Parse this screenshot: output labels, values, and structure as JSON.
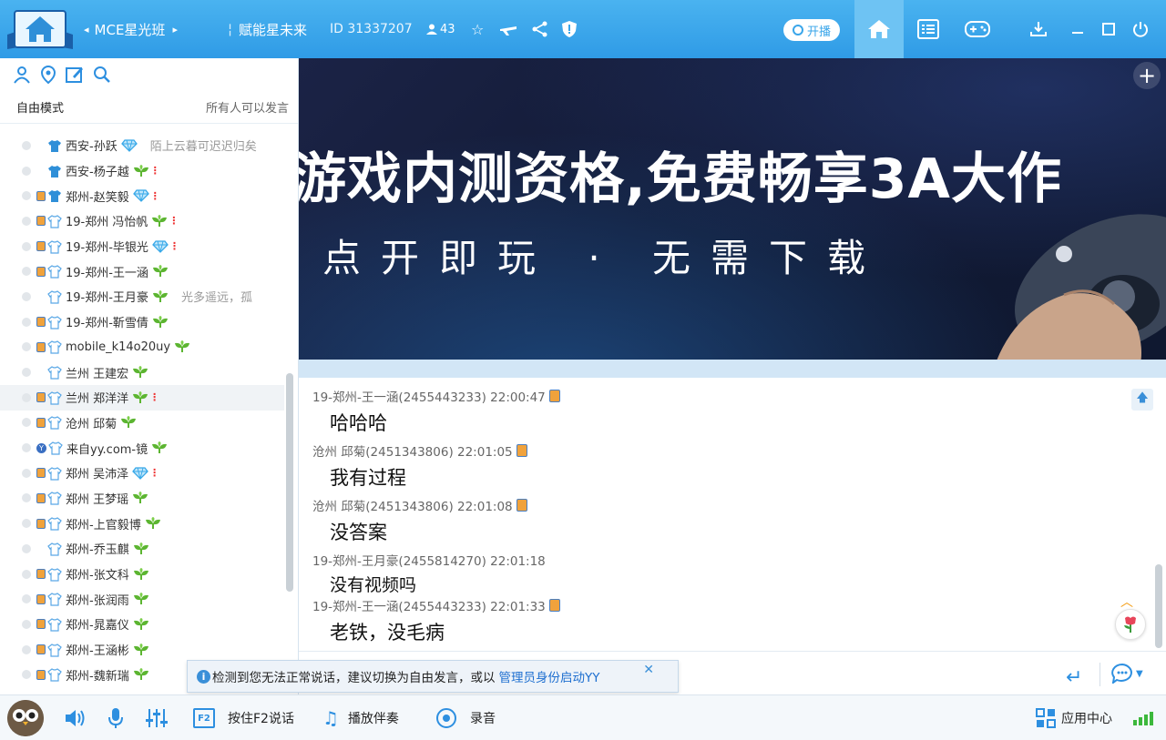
{
  "titlebar": {
    "channel_name": "MCE星光班",
    "sub_channel": "赋能星未来",
    "channel_id": "ID 31337207",
    "online_count": "43",
    "live_label": "开播"
  },
  "left": {
    "mode": "自由模式",
    "mode_desc": "所有人可以发言",
    "members": [
      {
        "name": "西安-孙跃",
        "sign": "陌上云暮可迟迟归矣",
        "dev": false,
        "tag": "diamond",
        "excl": false,
        "shirt": "#2f8fd8"
      },
      {
        "name": "西安-杨子越",
        "sign": "",
        "dev": false,
        "tag": "leaf",
        "excl": true,
        "shirt": "#2f8fd8"
      },
      {
        "name": "郑州-赵笑毅",
        "sign": "",
        "dev": true,
        "tag": "diamond",
        "excl": true,
        "shirt": "#2f8fd8"
      },
      {
        "name": "19-郑州  冯怡帆",
        "sign": "",
        "dev": true,
        "tag": "leaf",
        "excl": true,
        "shirt": "outline"
      },
      {
        "name": "19-郑州-毕银光",
        "sign": "",
        "dev": true,
        "tag": "diamond",
        "excl": true,
        "shirt": "outline"
      },
      {
        "name": "19-郑州-王一涵",
        "sign": "",
        "dev": true,
        "tag": "leaf",
        "excl": false,
        "shirt": "outline"
      },
      {
        "name": "19-郑州-王月豪",
        "sign": "光多遥远，孤",
        "dev": false,
        "tag": "leaf",
        "excl": false,
        "shirt": "outline"
      },
      {
        "name": "19-郑州-靳雪倩",
        "sign": "",
        "dev": true,
        "tag": "leaf",
        "excl": false,
        "shirt": "outline"
      },
      {
        "name": "mobile_k14o20uy",
        "sign": "",
        "dev": true,
        "tag": "leaf",
        "excl": false,
        "shirt": "outline"
      },
      {
        "name": "兰州  王建宏",
        "sign": "",
        "dev": false,
        "tag": "leaf",
        "excl": false,
        "shirt": "outline"
      },
      {
        "name": "兰州 郑洋洋",
        "sign": "",
        "dev": true,
        "tag": "leaf",
        "excl": true,
        "shirt": "outline",
        "hl": true
      },
      {
        "name": "沧州 邱菊",
        "sign": "",
        "dev": true,
        "tag": "leaf",
        "excl": false,
        "shirt": "outline"
      },
      {
        "name": "来自yy.com-镜",
        "sign": "",
        "dev": "yy",
        "tag": "leaf",
        "excl": false,
        "shirt": "outline"
      },
      {
        "name": "郑州 吴沛泽",
        "sign": "",
        "dev": true,
        "tag": "diamond",
        "excl": true,
        "shirt": "outline"
      },
      {
        "name": "郑州 王梦瑶",
        "sign": "",
        "dev": true,
        "tag": "leaf",
        "excl": false,
        "shirt": "outline"
      },
      {
        "name": "郑州-上官毅博",
        "sign": "",
        "dev": true,
        "tag": "leaf",
        "excl": false,
        "shirt": "outline"
      },
      {
        "name": "郑州-乔玉麒",
        "sign": "",
        "dev": false,
        "tag": "leaf",
        "excl": false,
        "shirt": "outline"
      },
      {
        "name": "郑州-张文科",
        "sign": "",
        "dev": true,
        "tag": "leaf",
        "excl": false,
        "shirt": "outline"
      },
      {
        "name": "郑州-张润雨",
        "sign": "",
        "dev": true,
        "tag": "leaf",
        "excl": false,
        "shirt": "outline"
      },
      {
        "name": "郑州-晁嘉仪",
        "sign": "",
        "dev": true,
        "tag": "leaf",
        "excl": false,
        "shirt": "outline"
      },
      {
        "name": "郑州-王涵彬",
        "sign": "",
        "dev": true,
        "tag": "leaf",
        "excl": false,
        "shirt": "outline"
      },
      {
        "name": "郑州-魏新瑞",
        "sign": "",
        "dev": true,
        "tag": "leaf",
        "excl": false,
        "shirt": "outline"
      }
    ]
  },
  "banner": {
    "headline": "游戏内测资格,免费畅享3A大作",
    "subline": "点开即玩 · 无需下载"
  },
  "chat": {
    "messages": [
      {
        "meta": "19-郑州-王一涵(2455443233) 22:00:47",
        "dev": true,
        "text": "哈哈哈",
        "small": false
      },
      {
        "meta": "沧州 邱菊(2451343806) 22:01:05",
        "dev": true,
        "text": "我有过程",
        "small": false
      },
      {
        "meta": "沧州 邱菊(2451343806) 22:01:08",
        "dev": true,
        "text": "没答案",
        "small": false
      },
      {
        "meta": "19-郑州-王月豪(2455814270) 22:01:18",
        "dev": false,
        "text": "没有视频吗",
        "small": true
      },
      {
        "meta": "19-郑州-王一涵(2455443233) 22:01:33",
        "dev": true,
        "text": "老铁，没毛病",
        "small": false
      }
    ]
  },
  "notice": {
    "text": "检测到您无法正常说话，建议切换为自由发言，或以",
    "link": "管理员身份启动YY"
  },
  "bottom": {
    "ptt_key": "F2",
    "ptt_label": "按住F2说话",
    "accompany_label": "播放伴奏",
    "record_label": "录音",
    "app_center_label": "应用中心"
  },
  "colors": {
    "titlebar": "#3aa6ea",
    "accent": "#2d8fe0",
    "leaf": "#5cb531",
    "diamond": "#37a8e8",
    "device": "#f0a23c"
  }
}
